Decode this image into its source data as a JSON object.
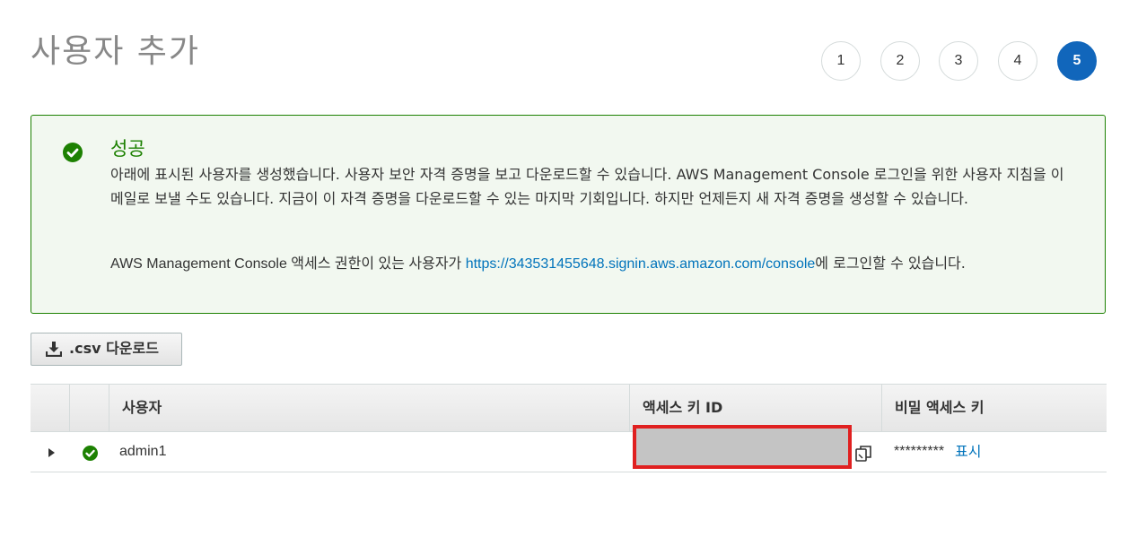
{
  "page": {
    "title": "사용자 추가"
  },
  "steps": [
    {
      "label": "1",
      "active": false
    },
    {
      "label": "2",
      "active": false
    },
    {
      "label": "3",
      "active": false
    },
    {
      "label": "4",
      "active": false
    },
    {
      "label": "5",
      "active": true
    }
  ],
  "alert": {
    "icon": "check-circle-icon",
    "title": "성공",
    "body": "아래에 표시된 사용자를 생성했습니다. 사용자 보안 자격 증명을 보고 다운로드할 수 있습니다. AWS Management Console 로그인을 위한 사용자 지침을 이메일로 보낼 수도 있습니다. 지금이 이 자격 증명을 다운로드할 수 있는 마지막 기회입니다. 하지만 언제든지 새 자격 증명을 생성할 수 있습니다.",
    "console_prefix": "AWS Management Console 액세스 권한이 있는 사용자가 ",
    "console_link": "https://343531455648.signin.aws.amazon.com/console",
    "console_suffix": "에 로그인할 수 있습니다."
  },
  "download_button": {
    "icon": "download-icon",
    "label": ".csv 다운로드"
  },
  "table": {
    "columns": [
      "사용자",
      "액세스 키 ID",
      "비밀 액세스 키"
    ],
    "rows": [
      {
        "user": "admin1",
        "access_key_id": "",
        "secret_mask": "*********",
        "show_label": "표시"
      }
    ]
  },
  "colors": {
    "success": "#1d8102",
    "link": "#0073bb",
    "active_step": "#1166bb",
    "redaction_border": "#e02020",
    "redaction_fill": "#c4c4c4"
  }
}
